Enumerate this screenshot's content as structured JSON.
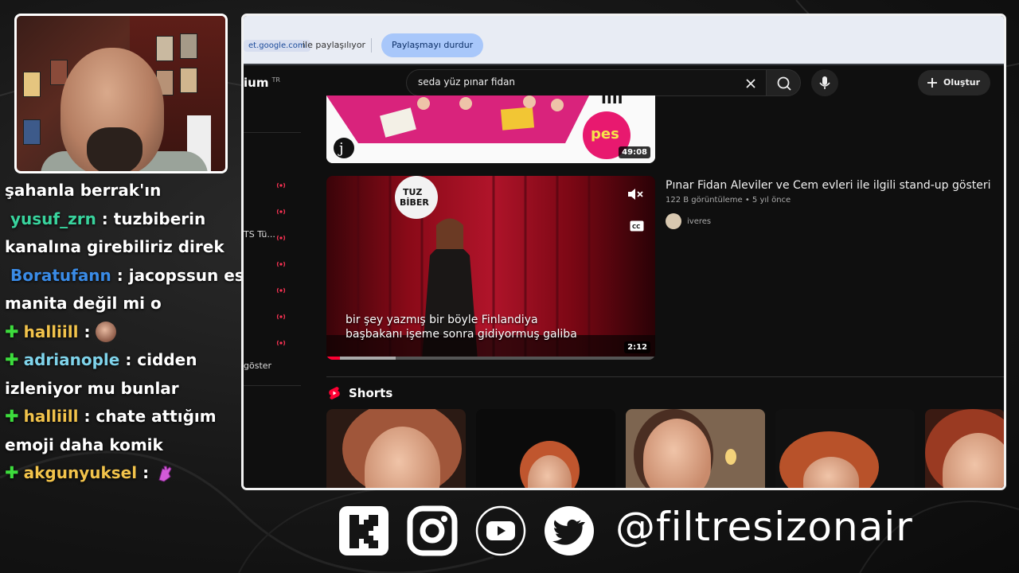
{
  "chat": [
    {
      "text": "şahanla berrak'ın"
    },
    {
      "user": "yusuf_zrn",
      "user_color": "#39d39d",
      "sep": " : ",
      "msg": "tuzbiberin"
    },
    {
      "text": "kanalına girebiliriz direk"
    },
    {
      "user": "Boratufann",
      "user_color": "#3a8be6",
      "sep": " : ",
      "msg": "jacopssun eski"
    },
    {
      "text": "manita değil mi o"
    },
    {
      "badge": "✚",
      "user": "halliill",
      "user_color": "#f2c34b",
      "sep": " : ",
      "emote": "face-emote"
    },
    {
      "badge": "✚",
      "user": "adrianople",
      "user_color": "#7fd3ea",
      "sep": " : ",
      "msg": "cidden"
    },
    {
      "text": "izleniyor mu bunlar"
    },
    {
      "badge": "✚",
      "user": "halliill",
      "user_color": "#f2c34b",
      "sep": " : ",
      "msg": "chate attığım"
    },
    {
      "text": "emoji daha komik"
    },
    {
      "badge": "✚",
      "user": "akgunyuksel",
      "user_color": "#f2c34b",
      "sep": " : ",
      "emote": "hand-emote"
    }
  ],
  "share_bar": {
    "host": "et.google.com",
    "sharing_text": "ile paylaşılıyor",
    "stop_label": "Paylaşmayı durdur"
  },
  "youtube": {
    "logo_text": "ium",
    "logo_region": "TR",
    "search_value": "seda yüz pınar fidan",
    "create_label": "Oluştur",
    "sidebar_items": [
      "TS Tü...",
      "göster"
    ],
    "video1": {
      "duration": "49:08"
    },
    "video2": {
      "duration": "2:12",
      "subtitle_line1": "bir şey yazmış bir böyle Finlandiya",
      "subtitle_line2": "başbakanı işeme sonra gidiyormuş galiba",
      "title": "Pınar Fidan Aleviler ve Cem evleri ile ilgili stand-up gösteri",
      "views": "122 B görüntüleme",
      "age": "5 yıl önce",
      "channel": "iveres",
      "progress": 0.04,
      "buffered": 0.21
    },
    "shorts_heading": "Shorts",
    "brand_red": "#ff0033"
  },
  "socials": {
    "icons": [
      "kick-icon",
      "instagram-icon",
      "youtube-icon",
      "twitter-icon"
    ],
    "handle": "@filtresizonair"
  }
}
